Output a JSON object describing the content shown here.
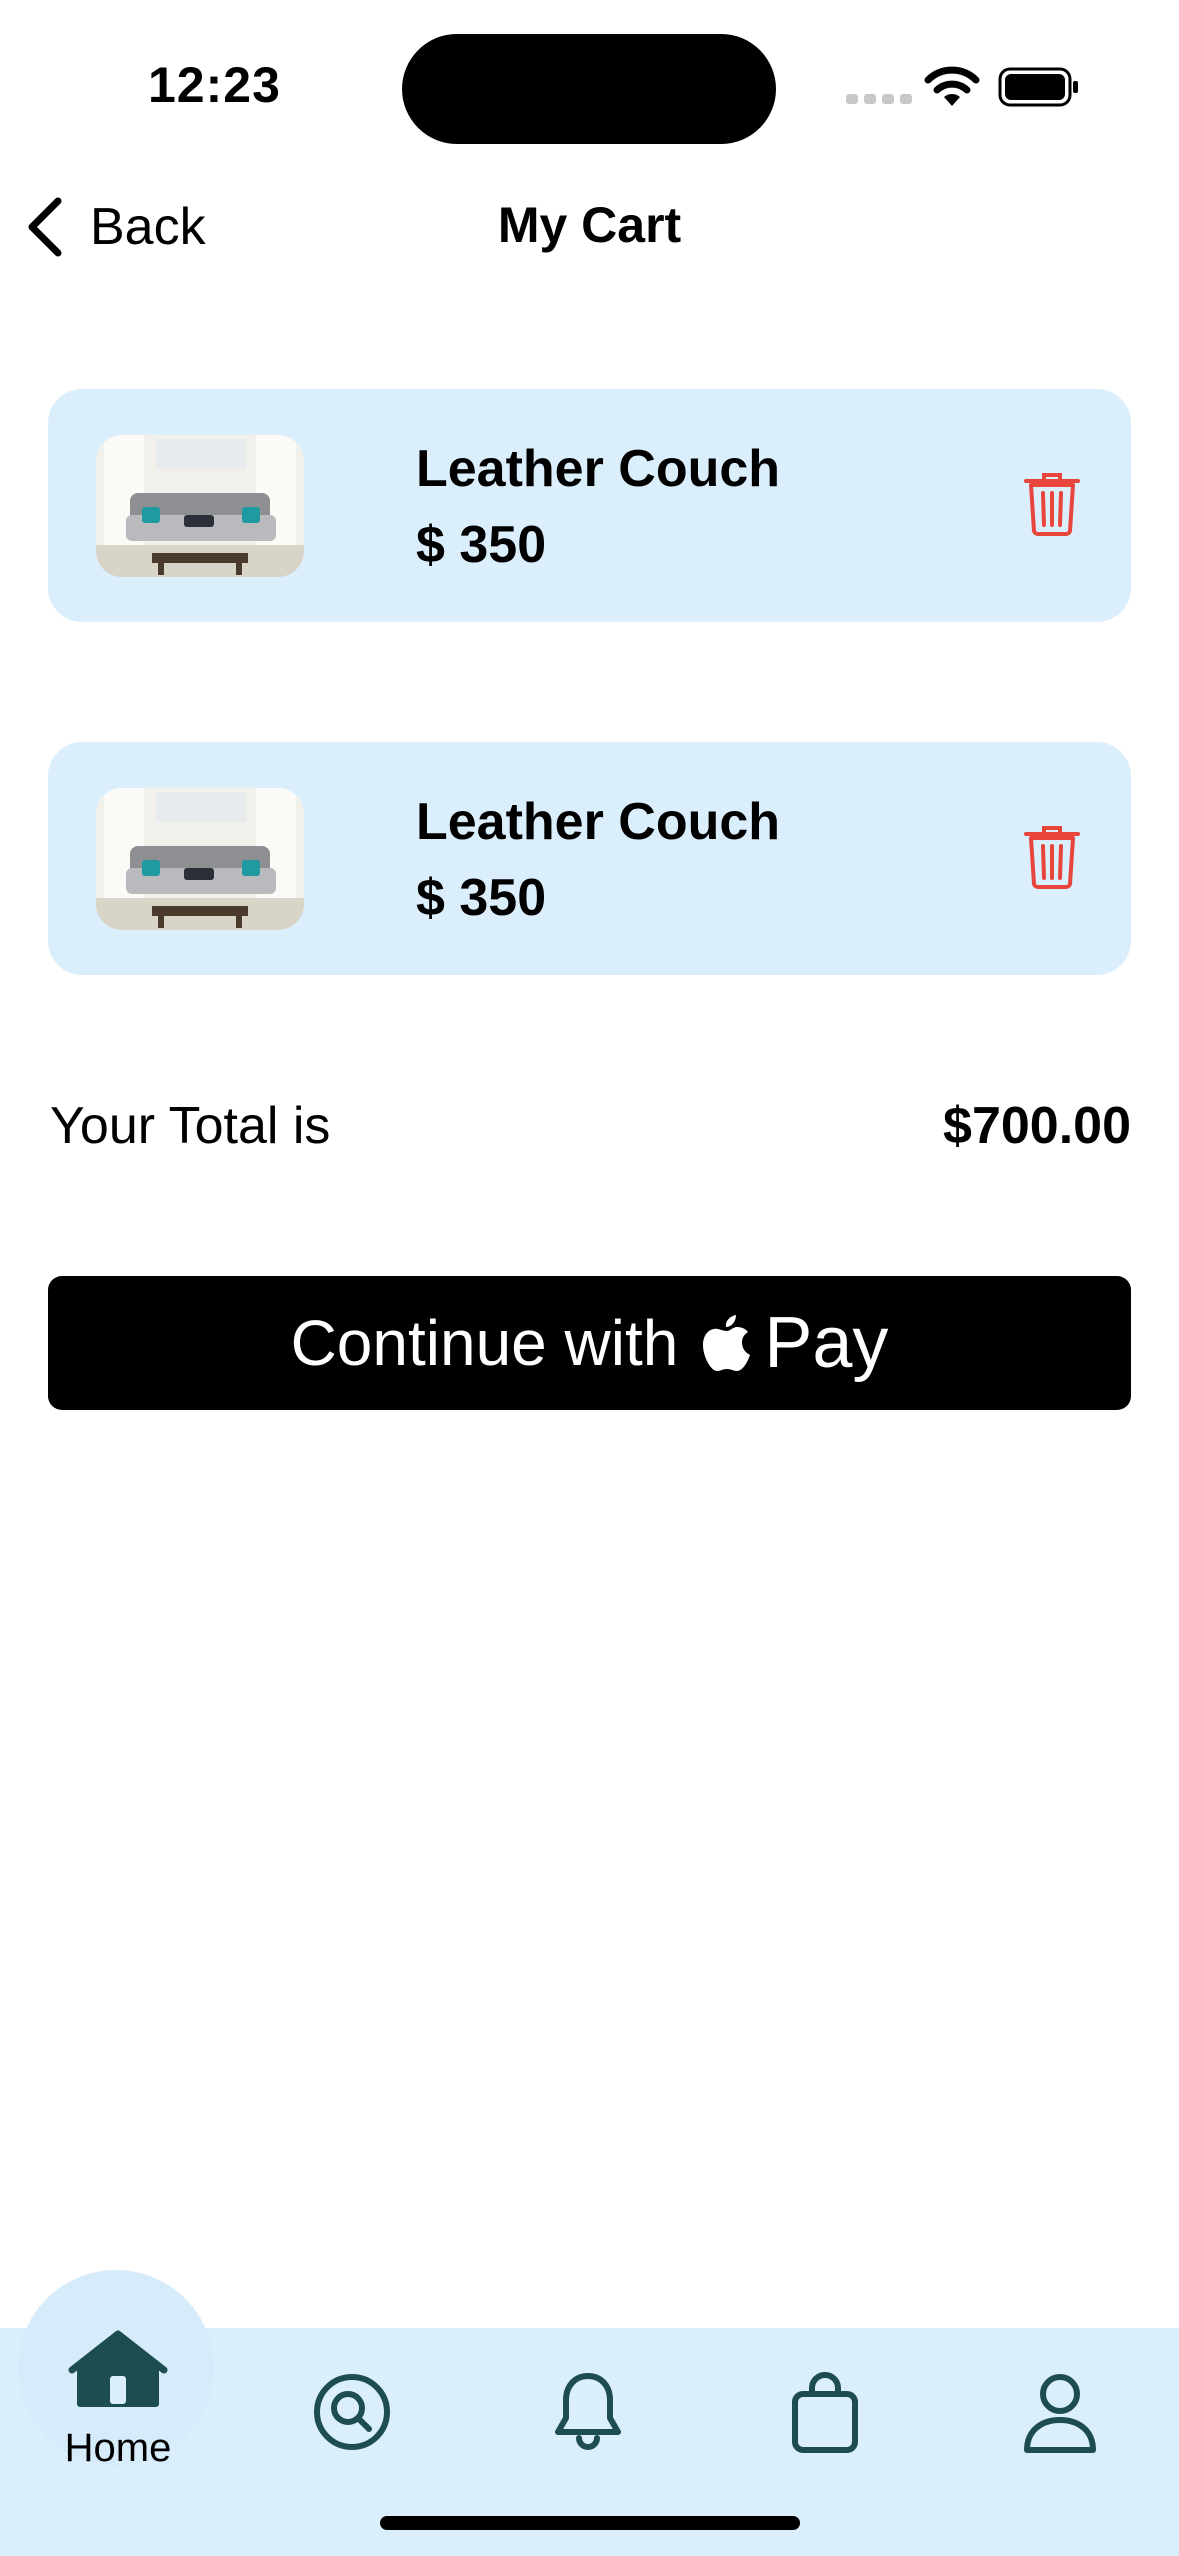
{
  "status_bar": {
    "time": "12:23"
  },
  "nav": {
    "back_label": "Back",
    "title": "My Cart"
  },
  "cart": {
    "items": [
      {
        "name": "Leather Couch",
        "price": "$ 350",
        "image": "sofa-photo"
      },
      {
        "name": "Leather Couch",
        "price": "$ 350",
        "image": "sofa-photo"
      }
    ]
  },
  "total": {
    "label": "Your Total is",
    "value": "$700.00"
  },
  "checkout": {
    "prefix": "Continue with",
    "pay_label": "Pay",
    "icon": "apple-logo-icon"
  },
  "tab_bar": {
    "items": [
      {
        "id": "home",
        "label": "Home",
        "icon": "home-icon",
        "active": true
      },
      {
        "id": "search",
        "icon": "search-icon"
      },
      {
        "id": "notifications",
        "icon": "bell-icon"
      },
      {
        "id": "cart",
        "icon": "bag-icon"
      },
      {
        "id": "profile",
        "icon": "person-icon"
      }
    ]
  },
  "colors": {
    "card_background": "#dbeefc",
    "tab_bar_background": "#dbeefc",
    "trash_red": "#e8453c",
    "tab_icon": "#1e4d4f",
    "button_black": "#000000"
  }
}
